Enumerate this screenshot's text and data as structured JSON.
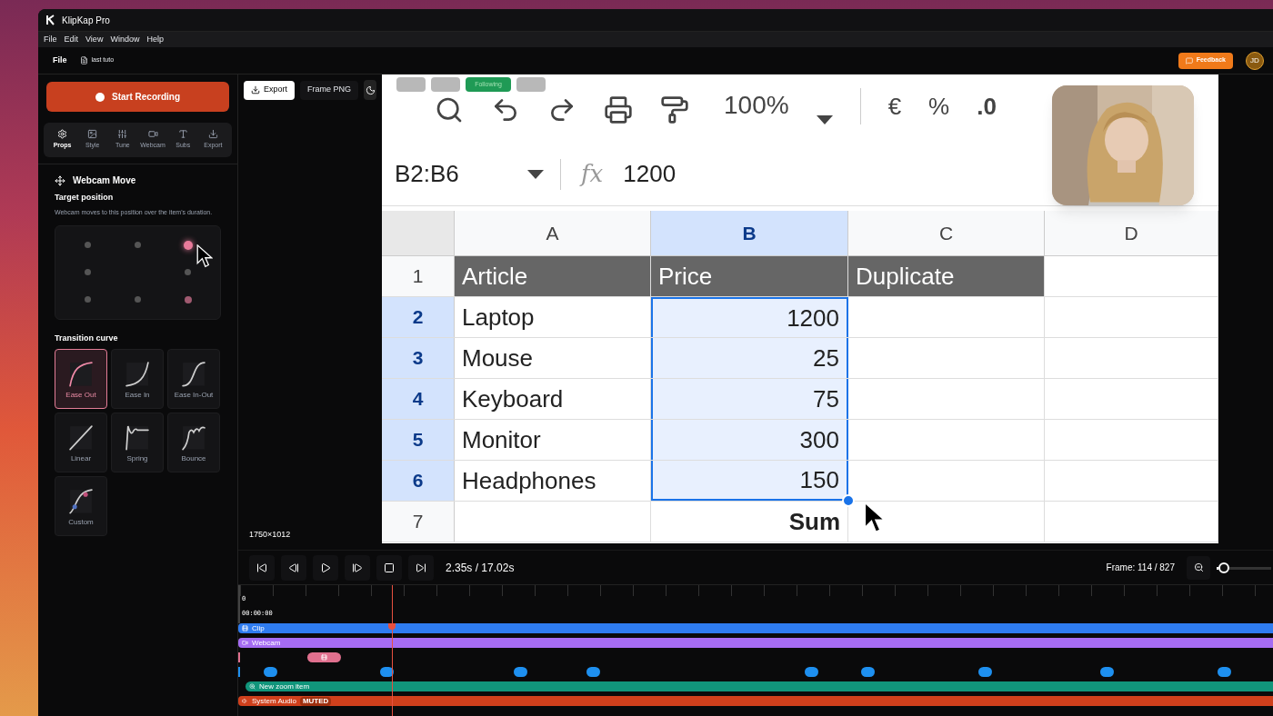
{
  "window": {
    "title": "KlipKap Pro"
  },
  "menu": [
    "File",
    "Edit",
    "View",
    "Window",
    "Help"
  ],
  "file_bar": {
    "label": "File",
    "project": "last tuto",
    "feedback": "Feedback",
    "avatar": "JD"
  },
  "sidebar": {
    "record_button": "Start Recording",
    "tabs": [
      {
        "label": "Props",
        "selected": true
      },
      {
        "label": "Style",
        "selected": false
      },
      {
        "label": "Tune",
        "selected": false
      },
      {
        "label": "Webcam",
        "selected": false
      },
      {
        "label": "Subs",
        "selected": false
      },
      {
        "label": "Export",
        "selected": false
      }
    ],
    "section_title": "Webcam Move",
    "target_label": "Target position",
    "target_hint": "Webcam moves to this position over the item's duration.",
    "positions": [
      {
        "selected": false,
        "previous": false
      },
      {
        "selected": false,
        "previous": false
      },
      {
        "selected": true,
        "previous": false
      },
      {
        "selected": false,
        "previous": false
      },
      {
        "selected": false,
        "previous": false
      },
      {
        "selected": false,
        "previous": false
      },
      {
        "selected": false,
        "previous": false
      },
      {
        "selected": false,
        "previous": true
      }
    ],
    "curves_label": "Transition curve",
    "curves": [
      {
        "label": "Ease Out",
        "kind": "ease-out",
        "selected": true
      },
      {
        "label": "Ease In",
        "kind": "ease-in",
        "selected": false
      },
      {
        "label": "Ease In-Out",
        "kind": "ease-in-out",
        "selected": false
      },
      {
        "label": "Linear",
        "kind": "linear",
        "selected": false
      },
      {
        "label": "Spring",
        "kind": "spring",
        "selected": false
      },
      {
        "label": "Bounce",
        "kind": "bounce",
        "selected": false
      },
      {
        "label": "Custom",
        "kind": "custom",
        "selected": false
      }
    ]
  },
  "toolbar": {
    "export": "Export",
    "frame_png": "Frame PNG",
    "overlay_buttons": [
      {
        "kind": "grey"
      },
      {
        "kind": "grey"
      },
      {
        "kind": "green",
        "label": "Following"
      },
      {
        "kind": "grey"
      }
    ]
  },
  "preview": {
    "resolution": "1750×1012",
    "sheet": {
      "zoom": "100%",
      "currency": "€",
      "percent": "%",
      "decimals": ".0",
      "cell_ref": "B2:B6",
      "fx": "fx",
      "formula": "1200",
      "columns": [
        {
          "label": "A",
          "selected": false
        },
        {
          "label": "B",
          "selected": true
        },
        {
          "label": "C",
          "selected": false
        },
        {
          "label": "D",
          "selected": false
        }
      ],
      "rows": [
        {
          "number": "1",
          "kind": "header",
          "selected": false,
          "cells": [
            "Article",
            "Price",
            "Duplicate"
          ]
        },
        {
          "number": "2",
          "kind": "data",
          "selected": true,
          "cells": [
            "Laptop",
            "1200",
            null
          ]
        },
        {
          "number": "3",
          "kind": "data",
          "selected": true,
          "cells": [
            "Mouse",
            "25",
            null
          ]
        },
        {
          "number": "4",
          "kind": "data",
          "selected": true,
          "cells": [
            "Keyboard",
            "75",
            null
          ]
        },
        {
          "number": "5",
          "kind": "data",
          "selected": true,
          "cells": [
            "Monitor",
            "300",
            null
          ]
        },
        {
          "number": "6",
          "kind": "data",
          "selected": true,
          "cells": [
            "Headphones",
            "150",
            null
          ]
        },
        {
          "number": "7",
          "kind": "total",
          "selected": false,
          "cells": [
            null,
            "Sum",
            null
          ]
        }
      ]
    }
  },
  "controls": {
    "time": "2.35s / 17.02s",
    "frame": "Frame: 114 / 827",
    "zoom": {
      "level": 0.04
    }
  },
  "timeline": {
    "ruler_start": "0",
    "timecode": "00:00:00",
    "tracks": [
      {
        "kind": "clip",
        "label": "Clip",
        "color": "#2f7cf0"
      },
      {
        "kind": "webcam",
        "label": "Webcam",
        "color": "#a56cf2"
      },
      {
        "kind": "move",
        "color": "#e0708e"
      },
      {
        "kind": "markers",
        "color": "#1e90f0"
      },
      {
        "kind": "zoom",
        "label": "New zoom item",
        "color": "#11957b"
      },
      {
        "kind": "audio",
        "label": "System Audio",
        "badge": "MUTED",
        "color": "#d0401c"
      }
    ]
  }
}
